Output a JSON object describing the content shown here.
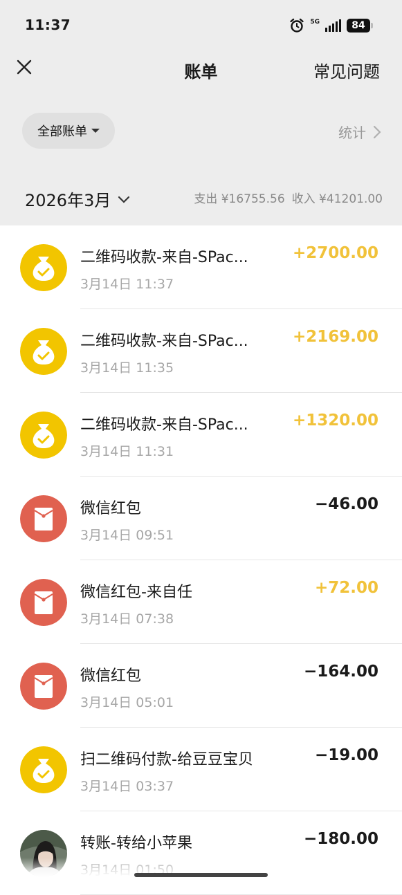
{
  "status_bar": {
    "time": "11:37",
    "network": "5G",
    "battery": "84",
    "icons": [
      "alarm-icon",
      "signal-icon",
      "battery-icon"
    ]
  },
  "nav": {
    "title": "账单",
    "faq": "常见问题",
    "close_icon": "close-icon"
  },
  "filter": {
    "label": "全部账单",
    "stats": "统计"
  },
  "month": {
    "label": "2026年3月",
    "summary_expense": "支出 ¥16755.56",
    "summary_income": "收入 ¥41201.00"
  },
  "colors": {
    "income": "#f1c23a",
    "expense": "#1a1a1a",
    "yellow_icon": "#f2c500",
    "red_icon": "#e06150",
    "background_header": "#ededed"
  },
  "transactions": [
    {
      "name": "二维码收款-来自-SPac...",
      "time": "3月14日 11:37",
      "amount": "+2700.00",
      "type": "income",
      "icon": "money-bag-icon"
    },
    {
      "name": "二维码收款-来自-SPac...",
      "time": "3月14日 11:35",
      "amount": "+2169.00",
      "type": "income",
      "icon": "money-bag-icon"
    },
    {
      "name": "二维码收款-来自-SPac...",
      "time": "3月14日 11:31",
      "amount": "+1320.00",
      "type": "income",
      "icon": "money-bag-icon"
    },
    {
      "name": "微信红包",
      "time": "3月14日 09:51",
      "amount": "−46.00",
      "type": "expense",
      "icon": "red-packet-icon"
    },
    {
      "name": "微信红包-来自任",
      "time": "3月14日 07:38",
      "amount": "+72.00",
      "type": "income",
      "icon": "red-packet-icon"
    },
    {
      "name": "微信红包",
      "time": "3月14日 05:01",
      "amount": "−164.00",
      "type": "expense",
      "icon": "red-packet-icon"
    },
    {
      "name": "扫二维码付款-给豆豆宝贝",
      "time": "3月14日 03:37",
      "amount": "−19.00",
      "type": "expense",
      "icon": "money-bag-icon"
    },
    {
      "name": "转账-转给小苹果",
      "time": "3月14日 01:50",
      "amount": "−180.00",
      "type": "expense",
      "icon": "user-avatar"
    }
  ]
}
